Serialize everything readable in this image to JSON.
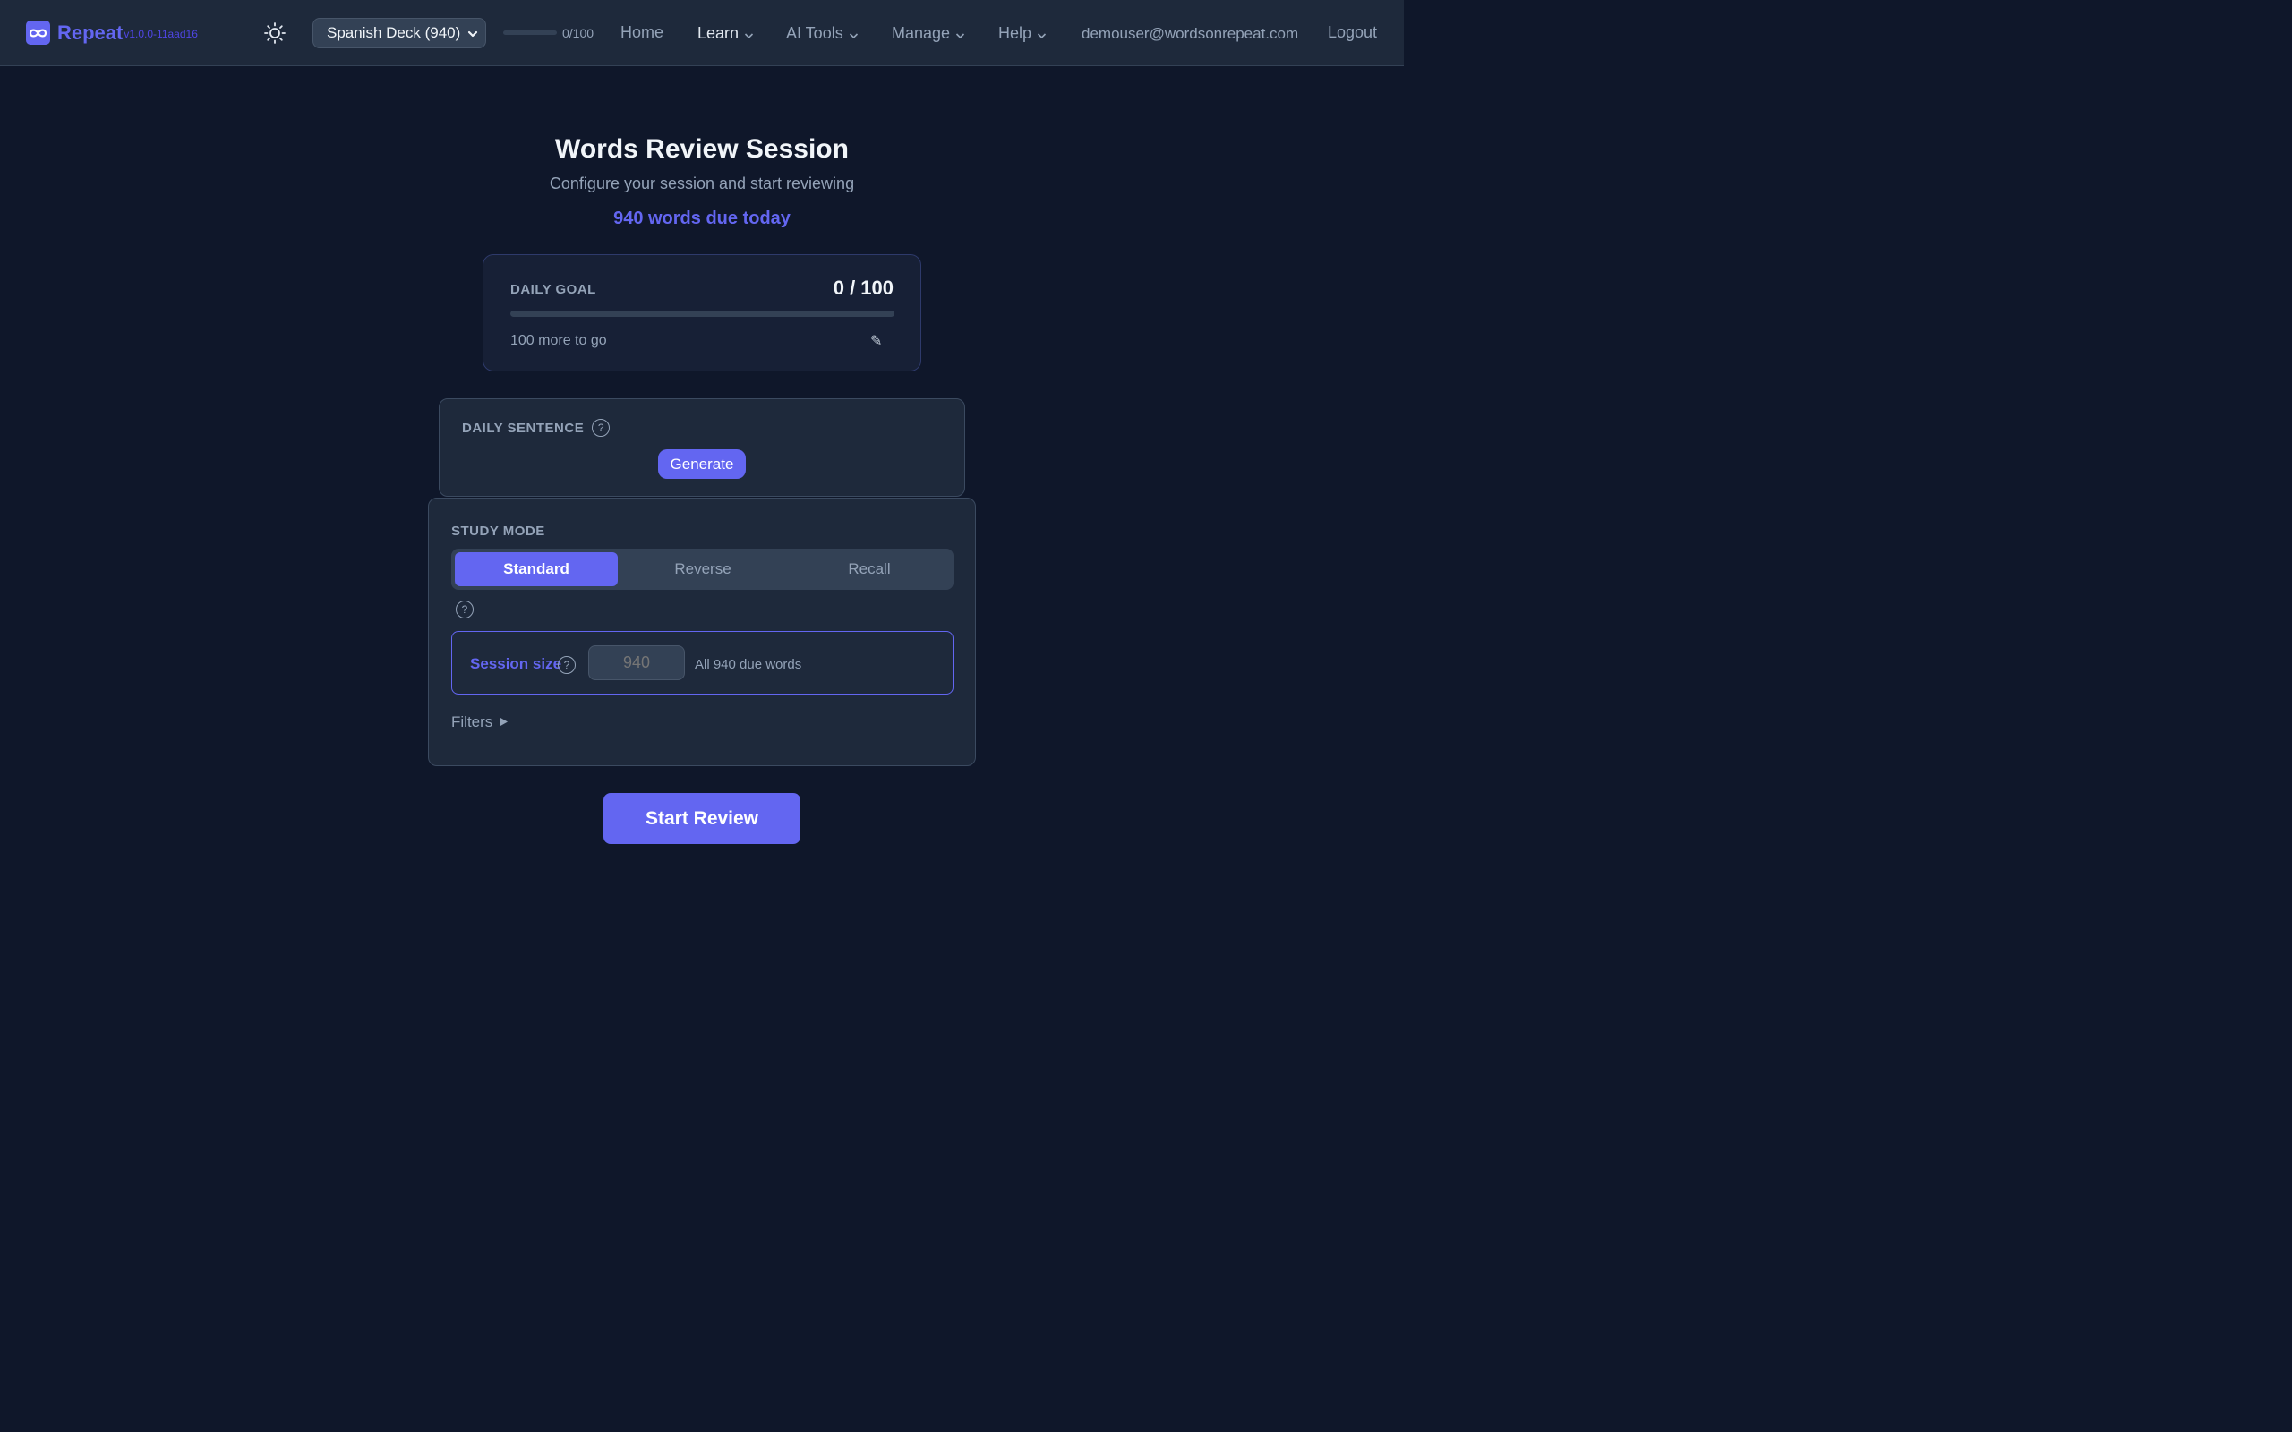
{
  "header": {
    "brand_name": "Repeat",
    "version": "v1.0.0-11aad16",
    "deck_selected": "Spanish Deck (940)",
    "goal_progress_text": "0/100",
    "goal_progress_fraction": 0,
    "nav": {
      "home": "Home",
      "learn": "Learn",
      "ai_tools": "AI Tools",
      "manage": "Manage",
      "help": "Help"
    },
    "user_email": "demouser@wordsonrepeat.com",
    "logout": "Logout"
  },
  "main": {
    "title": "Words Review Session",
    "subtitle": "Configure your session and start reviewing",
    "due_text": "940 words due today"
  },
  "daily_goal": {
    "label": "DAILY GOAL",
    "value": "0 / 100",
    "progress_fraction": 0,
    "remaining": "100 more to go",
    "edit_icon": "pencil-icon"
  },
  "daily_sentence": {
    "label": "DAILY SENTENCE",
    "help": "?",
    "generate": "Generate"
  },
  "study_mode": {
    "label": "STUDY MODE",
    "tabs": [
      "Standard",
      "Reverse",
      "Recall"
    ],
    "active_tab": "Standard",
    "help": "?"
  },
  "session": {
    "label": "Session size",
    "help": "?",
    "placeholder": "940",
    "info": "All 940 due words"
  },
  "filters": {
    "label": "Filters"
  },
  "start_button": "Start Review",
  "colors": {
    "accent": "#6366f1",
    "background": "#0f172a",
    "card": "#1e293b",
    "muted_text": "#94a3b8"
  }
}
